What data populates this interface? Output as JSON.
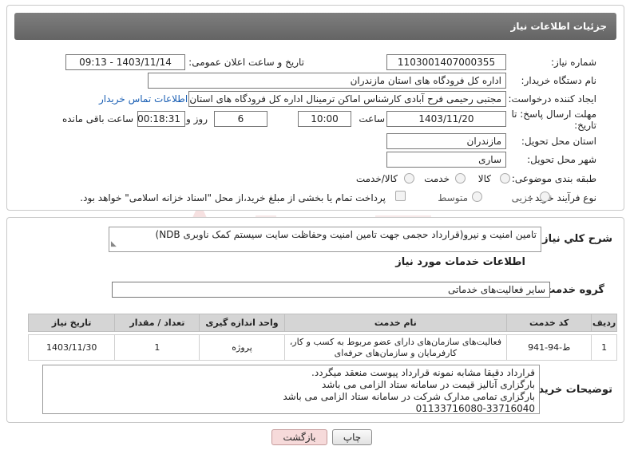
{
  "header": {
    "title": "جزئیات اطلاعات نیاز"
  },
  "fields": {
    "need_number_label": "شماره نیاز:",
    "need_number": "1103001407000355",
    "announce_label": "تاریخ و ساعت اعلان عمومی:",
    "announce_value": "1403/11/14 - 09:13",
    "buyer_org_label": "نام دستگاه خریدار:",
    "buyer_org": "اداره کل فرودگاه های استان مازندران",
    "creator_label": "ایجاد کننده درخواست:",
    "creator": "مجتبی رحیمی فرح آبادی کارشناس اماکن ترمینال اداره کل فرودگاه های استان مازندران",
    "contact_link": "اطلاعات تماس خریدار",
    "deadline_label_1": "مهلت ارسال پاسخ: تا",
    "deadline_label_2": "تاریخ:",
    "deadline_date": "1403/11/20",
    "time_label": "ساعت",
    "deadline_time": "10:00",
    "days_value": "6",
    "days_label": "روز و",
    "remaining_time": "00:18:31",
    "remaining_label": "ساعت باقی مانده",
    "province_label": "استان محل تحویل:",
    "province": "مازندران",
    "city_label": "شهر محل تحویل:",
    "city": "ساری",
    "category_label": "طبقه بندی موضوعی:",
    "category_options": [
      "کالا",
      "خدمت",
      "کالا/خدمت"
    ],
    "process_label": "نوع فرآیند خرید :",
    "process_options": [
      "جزیی",
      "متوسط"
    ],
    "payment_note": "پرداخت تمام یا بخشی از مبلغ خرید،از محل \"اسناد خزانه اسلامی\" خواهد بود."
  },
  "summary": {
    "label": "شرح کلي نياز:",
    "value": "تامین امنیت و نیرو(قرارداد حجمی جهت تامین امنیت وحفاظت سایت سیستم کمک ناوبری NDB)"
  },
  "services": {
    "section_title": "اطلاعات خدمات مورد نیاز",
    "group_label": "گروه خدمت:",
    "group_value": "سایر فعالیت‌های خدماتی",
    "columns": [
      "ردیف",
      "کد خدمت",
      "نام خدمت",
      "واحد اندازه گیری",
      "تعداد / مقدار",
      "تاریخ نیاز"
    ],
    "rows": [
      [
        "1",
        "ط-94-941",
        "فعالیت‌های سازمان‌های دارای عضو مربوط به کسب و کار، کارفرمایان و سازمان‌های حرفه‌ای",
        "پروژه",
        "1",
        "1403/11/30"
      ]
    ]
  },
  "buyer_notes": {
    "label": "توضیحات خریدار:",
    "lines": [
      "قرارداد دقیقا مشابه نمونه قرارداد پیوست منعقد میگردد.",
      "بارگزاری آنالیز قیمت در سامانه ستاد الزامی می باشد",
      "بارگزاری تمامی مدارک شرکت در سامانه ستاد الزامی می باشد",
      "01133716080-33716040"
    ]
  },
  "buttons": {
    "print": "چاپ",
    "back": "بازگشت"
  },
  "colors": {
    "titlebar": "#737373",
    "link": "#1a5fb4",
    "back_button": "#f6dada"
  }
}
